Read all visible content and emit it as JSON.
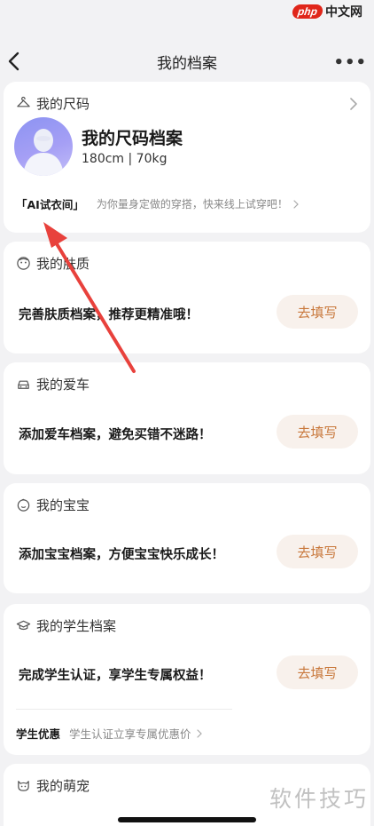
{
  "watermark": {
    "php": "php",
    "site": "中文网",
    "bottom": "软件技巧"
  },
  "nav": {
    "title": "我的档案",
    "more": "•••"
  },
  "size_card": {
    "section_title": "我的尺码",
    "profile_title": "我的尺码档案",
    "profile_info": "180cm | 70kg",
    "ai_tag": "「AI试衣间」",
    "ai_desc": "为你量身定做的穿搭，快来线上试穿吧！"
  },
  "skin_card": {
    "section_title": "我的肤质",
    "message": "完善肤质档案，推荐更精准哦！",
    "button": "去填写"
  },
  "car_card": {
    "section_title": "我的爱车",
    "message": "添加爱车档案，避免买错不迷路！",
    "button": "去填写"
  },
  "baby_card": {
    "section_title": "我的宝宝",
    "message": "添加宝宝档案，方便宝宝快乐成长！",
    "button": "去填写"
  },
  "student_card": {
    "section_title": "我的学生档案",
    "message": "完成学生认证，享学生专属权益！",
    "button": "去填写",
    "promo_label": "学生优惠",
    "promo_desc": "学生认证立享专属优惠价"
  },
  "pet_card": {
    "section_title": "我的萌宠"
  },
  "colors": {
    "accent": "#c8773a",
    "button_bg": "#f8f1ec",
    "arrow": "#e8413c"
  }
}
